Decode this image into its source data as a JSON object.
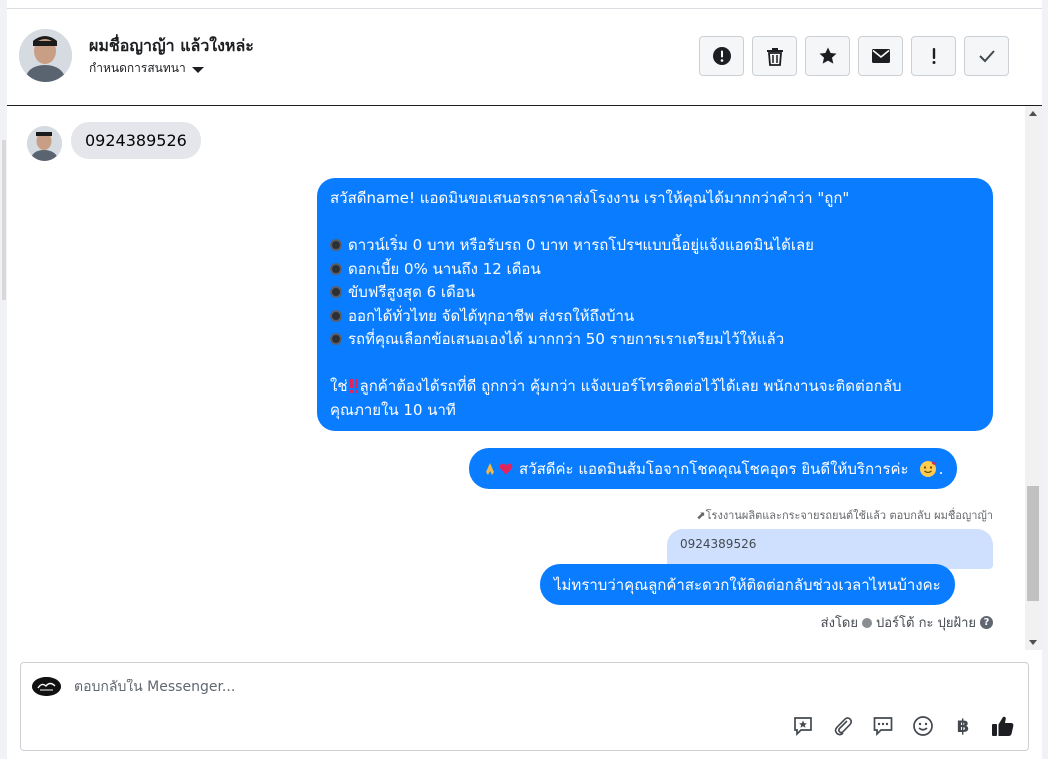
{
  "header": {
    "contact_name": "ผมชื่อญาญ้า แล้วใงหล่ะ",
    "assign_label": "กำหนดการสนทนา",
    "actions": [
      {
        "name": "spam-button",
        "icon": "exclamation-circle-icon"
      },
      {
        "name": "delete-button",
        "icon": "trash-icon"
      },
      {
        "name": "star-button",
        "icon": "star-icon"
      },
      {
        "name": "mark-unread-button",
        "icon": "envelope-icon"
      },
      {
        "name": "follow-up-button",
        "icon": "exclamation-icon"
      },
      {
        "name": "mark-done-button",
        "icon": "checkmark-icon"
      }
    ]
  },
  "messages": {
    "incoming": {
      "text": "0924389526"
    },
    "outgoing_promo": {
      "lines": [
        "สวัสดีname! แอดมินขอเสนอรถราคาส่งโรงงาน เราให้คุณได้มากกว่าคำว่า \"ถูก\"",
        "",
        "ดาวน์เริ่ม 0 บาท หรือรับรถ 0 บาท หารถโปรฯแบบนี้อยู่แจ้งแอดมินได้เลย",
        "ดอกเบี้ย 0% นานถึง 12 เดือน",
        "ขับฟรีสูงสุด 6 เดือน",
        "ออกได้ทั่วไทย จัดได้ทุกอาชีพ ส่งรถให้ถึงบ้าน",
        "รถที่คุณเลือกข้อเสนอเองได้ มากกว่า 50 รายการเราเตรียมไว้ให้แล้ว",
        "",
        "ลูกค้าต้องได้รถที่ดี ถูกกว่า คุ้มกว่า แจ้งเบอร์โทรติดต่อไว้ได้เลย พนักงานจะติดต่อกลับ",
        "คุณภายใน 10 นาที"
      ],
      "last_prefix": "ใช่"
    },
    "outgoing_greeting": {
      "text": "สวัสดีค่ะ แอดมินส้มโอจากโชคคุณโชคอุดร ยินดีให้บริการค่ะ",
      "suffix": "."
    },
    "reply_note": "โรงงานผลิตและกระจายรถยนต์ใช้แล้ว ตอบกลับ ผมชื่อญาญ้า",
    "quoted_text": "0924389526",
    "outgoing_question": {
      "text": "ไม่ทราบว่าคุณลูกค้าสะดวกให้ติดต่อกลับช่วงเวลาไหนบ้างคะ"
    },
    "sent_by_label": "ส่งโดย",
    "sent_by_name": "ปอร์โต้ กะ ปุยฝ้าย"
  },
  "composer": {
    "placeholder": "ตอบกลับใน Messenger...",
    "baht_symbol": "฿",
    "tools": [
      "saved-reply-icon",
      "attachment-icon",
      "message-bubble-icon",
      "emoji-icon",
      "baht-icon",
      "thumbs-up-icon"
    ]
  },
  "colors": {
    "outgoing_bubble": "#0a7cff",
    "incoming_bubble": "#e4e6eb",
    "quote_bubble": "#cfe0ff"
  }
}
